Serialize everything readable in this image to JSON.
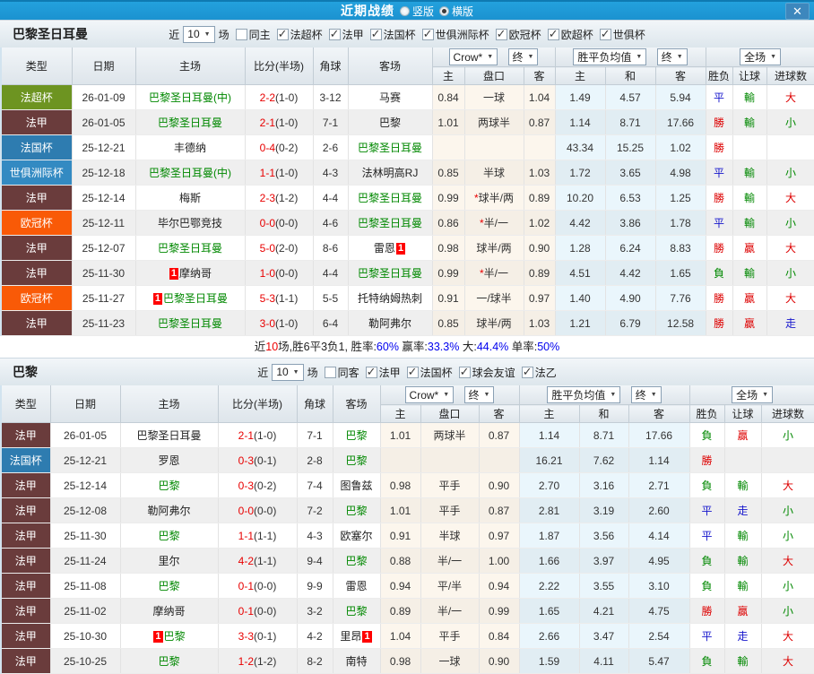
{
  "icons": {
    "chevron": "▼",
    "check": "✓",
    "close": "✕"
  },
  "topbar": {
    "title": "近期战绩",
    "layout_options": [
      {
        "label": "竖版",
        "selected": false
      },
      {
        "label": "横版",
        "selected": true
      }
    ],
    "close_glyph": "✕"
  },
  "columns": {
    "type": "类型",
    "date": "日期",
    "home": "主场",
    "score": "比分(半场)",
    "corners": "角球",
    "away": "客场",
    "odds_home": "主",
    "odds_handicap": "盘口",
    "odds_away": "客",
    "avg_home": "主",
    "avg_draw": "和",
    "avg_away": "客",
    "result": "胜负",
    "handicap_result": "让球",
    "goals": "进球数"
  },
  "selects": {
    "crow": "Crow*",
    "final1": "终",
    "avg": "胜平负均值",
    "final2": "终",
    "fullmatch": "全场"
  },
  "type_colors": {
    "法超杯": "#6d9421",
    "法甲": "#6a3c3c",
    "法国杯": "#2e7cb0",
    "世俱洲际杯": "#338ac2",
    "欧冠杯": "#f95a07"
  },
  "result_colors": {
    "red": "#dd0000",
    "blue": "#1515cc",
    "green": "#008800"
  },
  "sections": [
    {
      "title": "巴黎圣日耳曼",
      "filter": {
        "recent_label": "近",
        "count": "10",
        "matches_label": "场",
        "same_venue": {
          "label": "同主",
          "checked": false
        },
        "leagues": [
          {
            "label": "法超杯",
            "checked": true
          },
          {
            "label": "法甲",
            "checked": true
          },
          {
            "label": "法国杯",
            "checked": true
          },
          {
            "label": "世俱洲际杯",
            "checked": true
          },
          {
            "label": "欧冠杯",
            "checked": true
          },
          {
            "label": "欧超杯",
            "checked": true
          },
          {
            "label": "世俱杯",
            "checked": true
          }
        ]
      },
      "rows": [
        {
          "type": "法超杯",
          "date": "26-01-09",
          "home": "巴黎圣日耳曼(中)",
          "home_green": true,
          "home_badge": "",
          "score_ft": "2-2",
          "score_ht": "(1-0)",
          "corners": "3-12",
          "away": "马赛",
          "away_green": false,
          "away_badge": "",
          "crow_home": "0.84",
          "handicap": "一球",
          "handicap_star": false,
          "crow_away": "1.04",
          "avg_home": "1.49",
          "avg_draw": "4.57",
          "avg_away": "5.94",
          "res_outcome": "平",
          "res_handicap": "輸",
          "res_goals": "大"
        },
        {
          "type": "法甲",
          "date": "26-01-05",
          "home": "巴黎圣日耳曼",
          "home_green": true,
          "home_badge": "",
          "score_ft": "2-1",
          "score_ht": "(1-0)",
          "corners": "7-1",
          "away": "巴黎",
          "away_green": false,
          "away_badge": "",
          "crow_home": "1.01",
          "handicap": "两球半",
          "handicap_star": false,
          "crow_away": "0.87",
          "avg_home": "1.14",
          "avg_draw": "8.71",
          "avg_away": "17.66",
          "res_outcome": "勝",
          "res_handicap": "輸",
          "res_goals": "小"
        },
        {
          "type": "法国杯",
          "date": "25-12-21",
          "home": "丰德纳",
          "home_green": false,
          "home_badge": "",
          "score_ft": "0-4",
          "score_ht": "(0-2)",
          "corners": "2-6",
          "away": "巴黎圣日耳曼",
          "away_green": true,
          "away_badge": "",
          "crow_home": "",
          "handicap": "",
          "handicap_star": false,
          "crow_away": "",
          "avg_home": "43.34",
          "avg_draw": "15.25",
          "avg_away": "1.02",
          "res_outcome": "勝",
          "res_handicap": "",
          "res_goals": ""
        },
        {
          "type": "世俱洲际杯",
          "date": "25-12-18",
          "home": "巴黎圣日耳曼(中)",
          "home_green": true,
          "home_badge": "",
          "score_ft": "1-1",
          "score_ht": "(1-0)",
          "corners": "4-3",
          "away": "法林明高RJ",
          "away_green": false,
          "away_badge": "",
          "crow_home": "0.85",
          "handicap": "半球",
          "handicap_star": false,
          "crow_away": "1.03",
          "avg_home": "1.72",
          "avg_draw": "3.65",
          "avg_away": "4.98",
          "res_outcome": "平",
          "res_handicap": "輸",
          "res_goals": "小"
        },
        {
          "type": "法甲",
          "date": "25-12-14",
          "home": "梅斯",
          "home_green": false,
          "home_badge": "",
          "score_ft": "2-3",
          "score_ht": "(1-2)",
          "corners": "4-4",
          "away": "巴黎圣日耳曼",
          "away_green": true,
          "away_badge": "",
          "crow_home": "0.99",
          "handicap": "球半/两",
          "handicap_star": true,
          "crow_away": "0.89",
          "avg_home": "10.20",
          "avg_draw": "6.53",
          "avg_away": "1.25",
          "res_outcome": "勝",
          "res_handicap": "輸",
          "res_goals": "大"
        },
        {
          "type": "欧冠杯",
          "date": "25-12-11",
          "home": "毕尔巴鄂竞技",
          "home_green": false,
          "home_badge": "",
          "score_ft": "0-0",
          "score_ht": "(0-0)",
          "corners": "4-6",
          "away": "巴黎圣日耳曼",
          "away_green": true,
          "away_badge": "",
          "crow_home": "0.86",
          "handicap": "半/一",
          "handicap_star": true,
          "crow_away": "1.02",
          "avg_home": "4.42",
          "avg_draw": "3.86",
          "avg_away": "1.78",
          "res_outcome": "平",
          "res_handicap": "輸",
          "res_goals": "小"
        },
        {
          "type": "法甲",
          "date": "25-12-07",
          "home": "巴黎圣日耳曼",
          "home_green": true,
          "home_badge": "",
          "score_ft": "5-0",
          "score_ht": "(2-0)",
          "corners": "8-6",
          "away": "雷恩",
          "away_green": false,
          "away_badge": "1",
          "crow_home": "0.98",
          "handicap": "球半/两",
          "handicap_star": false,
          "crow_away": "0.90",
          "avg_home": "1.28",
          "avg_draw": "6.24",
          "avg_away": "8.83",
          "res_outcome": "勝",
          "res_handicap": "贏",
          "res_goals": "大"
        },
        {
          "type": "法甲",
          "date": "25-11-30",
          "home": "摩纳哥",
          "home_green": false,
          "home_badge": "1",
          "score_ft": "1-0",
          "score_ht": "(0-0)",
          "corners": "4-4",
          "away": "巴黎圣日耳曼",
          "away_green": true,
          "away_badge": "",
          "crow_home": "0.99",
          "handicap": "半/一",
          "handicap_star": true,
          "crow_away": "0.89",
          "avg_home": "4.51",
          "avg_draw": "4.42",
          "avg_away": "1.65",
          "res_outcome": "負",
          "res_handicap": "輸",
          "res_goals": "小"
        },
        {
          "type": "欧冠杯",
          "date": "25-11-27",
          "home": "巴黎圣日耳曼",
          "home_green": true,
          "home_badge": "1",
          "score_ft": "5-3",
          "score_ht": "(1-1)",
          "corners": "5-5",
          "away": "托特纳姆热刺",
          "away_green": false,
          "away_badge": "",
          "crow_home": "0.91",
          "handicap": "一/球半",
          "handicap_star": false,
          "crow_away": "0.97",
          "avg_home": "1.40",
          "avg_draw": "4.90",
          "avg_away": "7.76",
          "res_outcome": "勝",
          "res_handicap": "贏",
          "res_goals": "大"
        },
        {
          "type": "法甲",
          "date": "25-11-23",
          "home": "巴黎圣日耳曼",
          "home_green": true,
          "home_badge": "",
          "score_ft": "3-0",
          "score_ht": "(1-0)",
          "corners": "6-4",
          "away": "勒阿弗尔",
          "away_green": false,
          "away_badge": "",
          "crow_home": "0.85",
          "handicap": "球半/两",
          "handicap_star": false,
          "crow_away": "1.03",
          "avg_home": "1.21",
          "avg_draw": "6.79",
          "avg_away": "12.58",
          "res_outcome": "勝",
          "res_handicap": "贏",
          "res_goals": "走"
        }
      ],
      "summary": [
        {
          "text": "近",
          "color": "#222"
        },
        {
          "text": "10",
          "color": "#ee0000"
        },
        {
          "text": "场,胜6平3负1, 胜率:",
          "color": "#222"
        },
        {
          "text": "60%",
          "color": "#0000ee"
        },
        {
          "text": " 赢率:",
          "color": "#222"
        },
        {
          "text": "33.3%",
          "color": "#0000ee"
        },
        {
          "text": " 大:",
          "color": "#222"
        },
        {
          "text": "44.4%",
          "color": "#0000ee"
        },
        {
          "text": " 单率:",
          "color": "#222"
        },
        {
          "text": "50%",
          "color": "#0000ee"
        }
      ]
    },
    {
      "title": "巴黎",
      "filter": {
        "recent_label": "近",
        "count": "10",
        "matches_label": "场",
        "same_venue": {
          "label": "同客",
          "checked": false
        },
        "leagues": [
          {
            "label": "法甲",
            "checked": true
          },
          {
            "label": "法国杯",
            "checked": true
          },
          {
            "label": "球会友谊",
            "checked": true
          },
          {
            "label": "法乙",
            "checked": true
          }
        ]
      },
      "rows": [
        {
          "type": "法甲",
          "date": "26-01-05",
          "home": "巴黎圣日耳曼",
          "home_green": false,
          "home_badge": "",
          "score_ft": "2-1",
          "score_ht": "(1-0)",
          "corners": "7-1",
          "away": "巴黎",
          "away_green": true,
          "away_badge": "",
          "crow_home": "1.01",
          "handicap": "两球半",
          "handicap_star": false,
          "crow_away": "0.87",
          "avg_home": "1.14",
          "avg_draw": "8.71",
          "avg_away": "17.66",
          "res_outcome": "負",
          "res_handicap": "贏",
          "res_goals": "小"
        },
        {
          "type": "法国杯",
          "date": "25-12-21",
          "home": "罗恩",
          "home_green": false,
          "home_badge": "",
          "score_ft": "0-3",
          "score_ht": "(0-1)",
          "corners": "2-8",
          "away": "巴黎",
          "away_green": true,
          "away_badge": "",
          "crow_home": "",
          "handicap": "",
          "handicap_star": false,
          "crow_away": "",
          "avg_home": "16.21",
          "avg_draw": "7.62",
          "avg_away": "1.14",
          "res_outcome": "勝",
          "res_handicap": "",
          "res_goals": ""
        },
        {
          "type": "法甲",
          "date": "25-12-14",
          "home": "巴黎",
          "home_green": true,
          "home_badge": "",
          "score_ft": "0-3",
          "score_ht": "(0-2)",
          "corners": "7-4",
          "away": "图鲁兹",
          "away_green": false,
          "away_badge": "",
          "crow_home": "0.98",
          "handicap": "平手",
          "handicap_star": false,
          "crow_away": "0.90",
          "avg_home": "2.70",
          "avg_draw": "3.16",
          "avg_away": "2.71",
          "res_outcome": "負",
          "res_handicap": "輸",
          "res_goals": "大"
        },
        {
          "type": "法甲",
          "date": "25-12-08",
          "home": "勒阿弗尔",
          "home_green": false,
          "home_badge": "",
          "score_ft": "0-0",
          "score_ht": "(0-0)",
          "corners": "7-2",
          "away": "巴黎",
          "away_green": true,
          "away_badge": "",
          "crow_home": "1.01",
          "handicap": "平手",
          "handicap_star": false,
          "crow_away": "0.87",
          "avg_home": "2.81",
          "avg_draw": "3.19",
          "avg_away": "2.60",
          "res_outcome": "平",
          "res_handicap": "走",
          "res_goals": "小"
        },
        {
          "type": "法甲",
          "date": "25-11-30",
          "home": "巴黎",
          "home_green": true,
          "home_badge": "",
          "score_ft": "1-1",
          "score_ht": "(1-1)",
          "corners": "4-3",
          "away": "欧塞尔",
          "away_green": false,
          "away_badge": "",
          "crow_home": "0.91",
          "handicap": "半球",
          "handicap_star": false,
          "crow_away": "0.97",
          "avg_home": "1.87",
          "avg_draw": "3.56",
          "avg_away": "4.14",
          "res_outcome": "平",
          "res_handicap": "輸",
          "res_goals": "小"
        },
        {
          "type": "法甲",
          "date": "25-11-24",
          "home": "里尔",
          "home_green": false,
          "home_badge": "",
          "score_ft": "4-2",
          "score_ht": "(1-1)",
          "corners": "9-4",
          "away": "巴黎",
          "away_green": true,
          "away_badge": "",
          "crow_home": "0.88",
          "handicap": "半/一",
          "handicap_star": false,
          "crow_away": "1.00",
          "avg_home": "1.66",
          "avg_draw": "3.97",
          "avg_away": "4.95",
          "res_outcome": "負",
          "res_handicap": "輸",
          "res_goals": "大"
        },
        {
          "type": "法甲",
          "date": "25-11-08",
          "home": "巴黎",
          "home_green": true,
          "home_badge": "",
          "score_ft": "0-1",
          "score_ht": "(0-0)",
          "corners": "9-9",
          "away": "雷恩",
          "away_green": false,
          "away_badge": "",
          "crow_home": "0.94",
          "handicap": "平/半",
          "handicap_star": false,
          "crow_away": "0.94",
          "avg_home": "2.22",
          "avg_draw": "3.55",
          "avg_away": "3.10",
          "res_outcome": "負",
          "res_handicap": "輸",
          "res_goals": "小"
        },
        {
          "type": "法甲",
          "date": "25-11-02",
          "home": "摩纳哥",
          "home_green": false,
          "home_badge": "",
          "score_ft": "0-1",
          "score_ht": "(0-0)",
          "corners": "3-2",
          "away": "巴黎",
          "away_green": true,
          "away_badge": "",
          "crow_home": "0.89",
          "handicap": "半/一",
          "handicap_star": false,
          "crow_away": "0.99",
          "avg_home": "1.65",
          "avg_draw": "4.21",
          "avg_away": "4.75",
          "res_outcome": "勝",
          "res_handicap": "贏",
          "res_goals": "小"
        },
        {
          "type": "法甲",
          "date": "25-10-30",
          "home": "巴黎",
          "home_green": true,
          "home_badge": "1",
          "score_ft": "3-3",
          "score_ht": "(0-1)",
          "corners": "4-2",
          "away": "里昂",
          "away_green": false,
          "away_badge": "1",
          "crow_home": "1.04",
          "handicap": "平手",
          "handicap_star": false,
          "crow_away": "0.84",
          "avg_home": "2.66",
          "avg_draw": "3.47",
          "avg_away": "2.54",
          "res_outcome": "平",
          "res_handicap": "走",
          "res_goals": "大"
        },
        {
          "type": "法甲",
          "date": "25-10-25",
          "home": "巴黎",
          "home_green": true,
          "home_badge": "",
          "score_ft": "1-2",
          "score_ht": "(1-2)",
          "corners": "8-2",
          "away": "南特",
          "away_green": false,
          "away_badge": "",
          "crow_home": "0.98",
          "handicap": "一球",
          "handicap_star": false,
          "crow_away": "0.90",
          "avg_home": "1.59",
          "avg_draw": "4.11",
          "avg_away": "5.47",
          "res_outcome": "負",
          "res_handicap": "輸",
          "res_goals": "大"
        }
      ],
      "summary": []
    }
  ]
}
